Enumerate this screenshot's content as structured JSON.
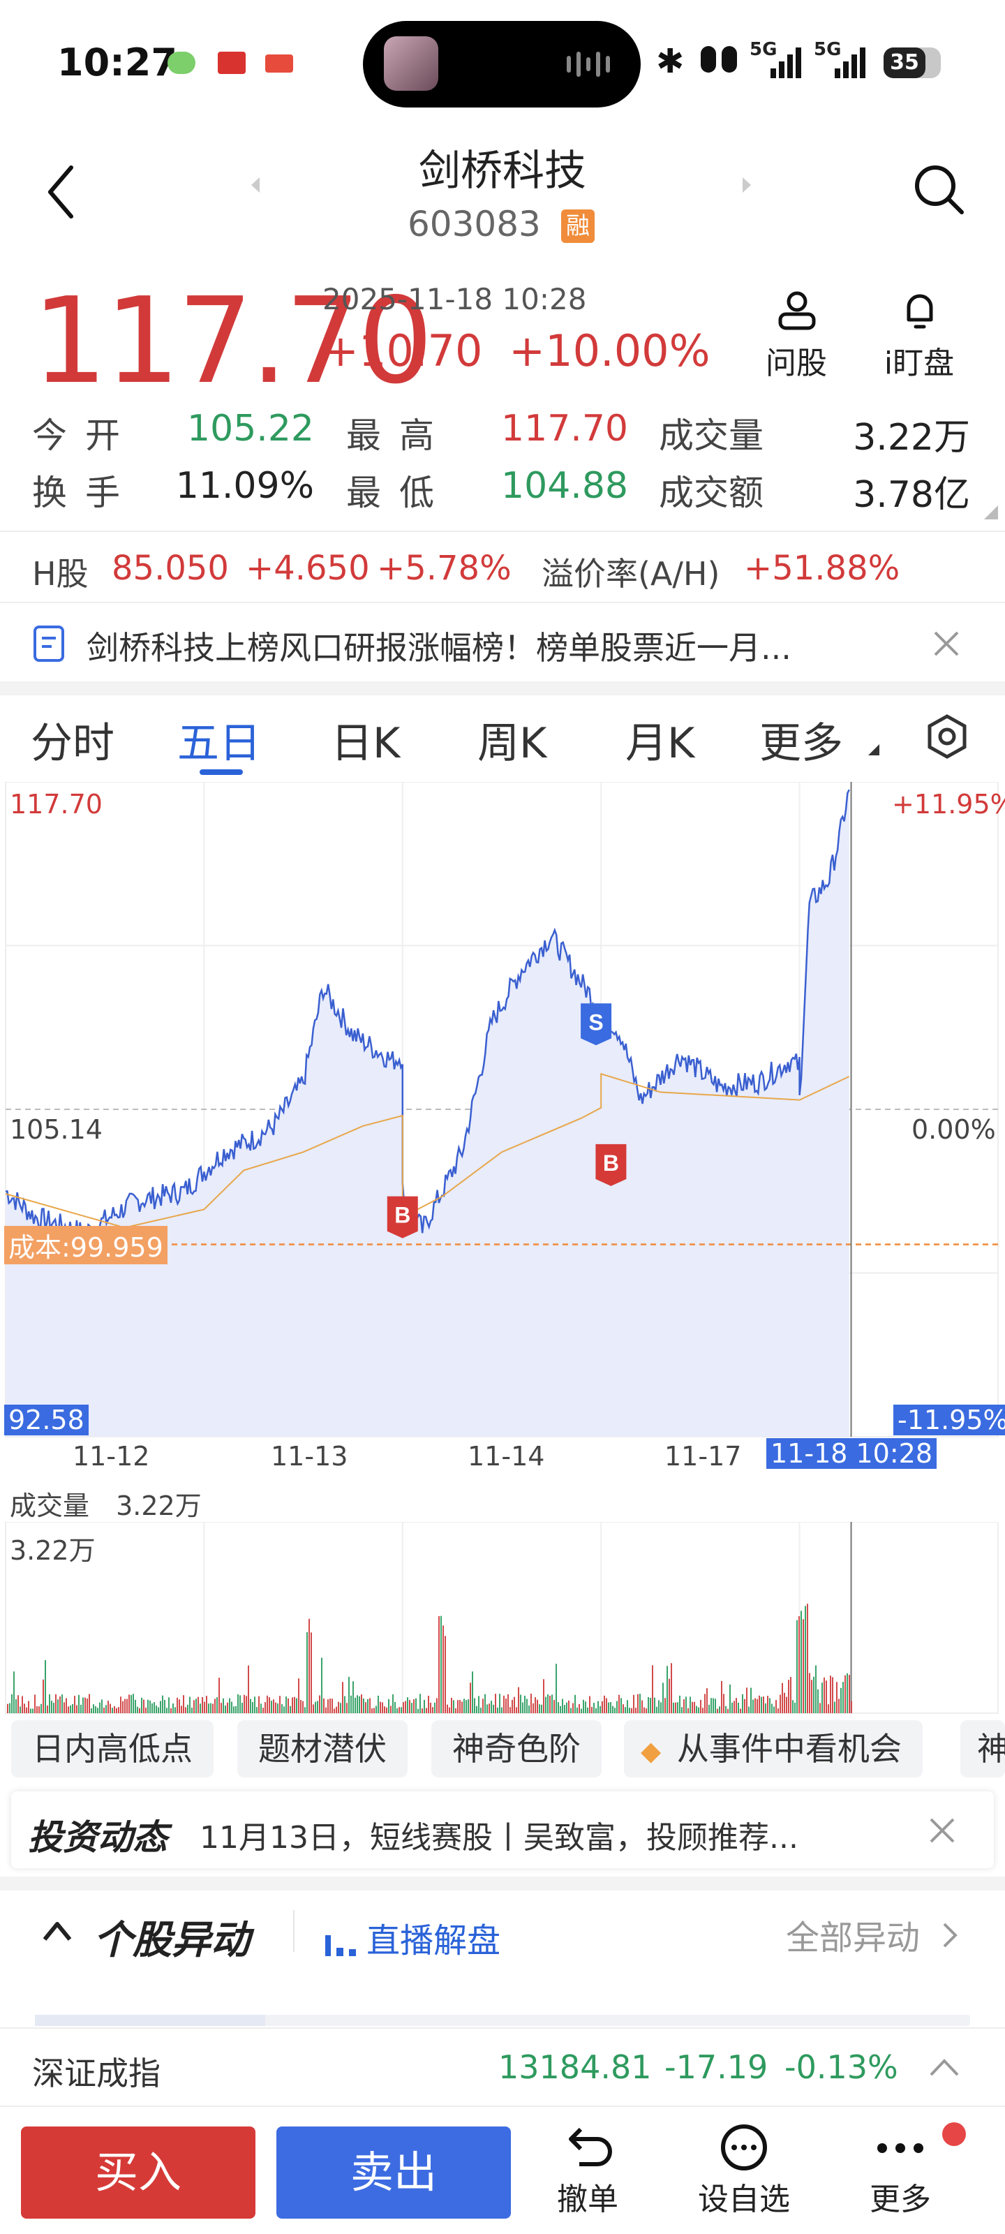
{
  "status_bar": {
    "time": "10:27",
    "battery": "35",
    "net1": "5G",
    "net2": "5G"
  },
  "header": {
    "title": "剑桥科技",
    "code": "603083",
    "margin_badge": "融"
  },
  "quote": {
    "price": "117.70",
    "datetime": "2025-11-18 10:28",
    "change": "+10.70",
    "change_pct": "+10.00%"
  },
  "tools": {
    "ask_label": "问股",
    "watch_label": "i盯盘"
  },
  "stats": [
    {
      "label": "今开",
      "value": "105.22",
      "color": "#2e9a5e"
    },
    {
      "label": "最高",
      "value": "117.70",
      "color": "#d23a3a"
    },
    {
      "label": "成交量",
      "value": "3.22万",
      "color": "#222222"
    },
    {
      "label": "换手",
      "value": "11.09%",
      "color": "#222222"
    },
    {
      "label": "最低",
      "value": "104.88",
      "color": "#2e9a5e"
    },
    {
      "label": "成交额",
      "value": "3.78亿",
      "color": "#222222"
    }
  ],
  "hshare": {
    "label": "H股",
    "price": "85.050",
    "change": "+4.650",
    "change_pct": "+5.78%",
    "premium_label": "溢价率(A/H)",
    "premium_value": "+51.88%"
  },
  "notice": {
    "text": "剑桥科技上榜风口研报涨幅榜！榜单股票近一月..."
  },
  "tabs": [
    "分时",
    "五日",
    "日K",
    "周K",
    "月K",
    "更多"
  ],
  "active_tab": "五日",
  "chart": {
    "top_price": "117.70",
    "top_pct": "+11.95%",
    "mid_price": "105.14",
    "mid_pct": "0.00%",
    "bottom_price": "92.58",
    "bottom_pct": "-11.95%",
    "cost_label": "成本:99.959",
    "dates": [
      "11-12",
      "11-13",
      "11-14",
      "11-17"
    ],
    "cursor_label": "11-18 10:28",
    "volume_label": "成交量",
    "volume_value": "3.22万",
    "volume_max": "3.22万",
    "marker_b": "B",
    "marker_s": "S"
  },
  "chart_data": {
    "type": "line",
    "series": [],
    "x": [
      "11-12",
      "11-13",
      "11-14",
      "11-17",
      "11-18"
    ],
    "close_values": [
      103.2,
      106.5,
      110.0,
      106.0,
      117.7
    ],
    "ylim": [
      92.58,
      117.7
    ],
    "reference": 105.14,
    "cost": 99.959
  },
  "tags": [
    "日内高低点",
    "题材潜伏",
    "神奇色阶",
    "从事件中看机会",
    "神"
  ],
  "news": {
    "brand": "投资动态",
    "text": "11月13日，短线赛股丨吴致富，投顾推荐..."
  },
  "anomaly": {
    "title": "个股异动",
    "live": "直播解盘",
    "all": "全部异动"
  },
  "index": {
    "name": "深证成指",
    "value": "13184.81",
    "change": "-17.19",
    "change_pct": "-0.13%"
  },
  "bottom": {
    "buy": "买入",
    "sell": "卖出",
    "cancel": "撤单",
    "watchlist": "设自选",
    "more": "更多"
  }
}
